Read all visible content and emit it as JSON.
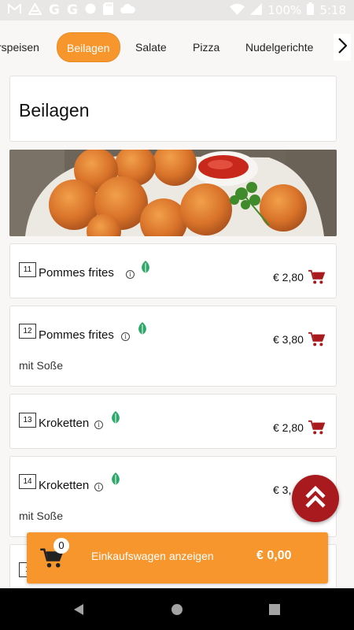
{
  "status_bar": {
    "battery": "100%",
    "time": "5:18",
    "icons": [
      "gmail-icon",
      "drive-icon",
      "google-icon",
      "google-icon",
      "circle-icon",
      "sd-card-icon",
      "cloud-icon",
      "wifi-icon",
      "signal-icon",
      "battery-icon"
    ]
  },
  "categories": [
    {
      "label": "rspeisen",
      "active": false
    },
    {
      "label": "Beilagen",
      "active": true
    },
    {
      "label": "Salate",
      "active": false
    },
    {
      "label": "Pizza",
      "active": false
    },
    {
      "label": "Nudelgerichte",
      "active": false
    }
  ],
  "section": {
    "title": "Beilagen"
  },
  "products": [
    {
      "number": "11",
      "name": "Pommes frites",
      "price": "€ 2,80",
      "description": ""
    },
    {
      "number": "12",
      "name": "Pommes frites",
      "price": "€ 3,80",
      "description": "mit Soße"
    },
    {
      "number": "13",
      "name": "Kroketten",
      "price": "€ 2,80",
      "description": ""
    },
    {
      "number": "14",
      "name": "Kroketten",
      "price": "€ 3,",
      "description": "mit Soße"
    },
    {
      "number": "1",
      "name": "",
      "price": "",
      "description": ""
    }
  ],
  "cart": {
    "count": "0",
    "label": "Einkaufswagen anzeigen",
    "total": "€ 0,00"
  },
  "colors": {
    "accent": "#f7962d",
    "cart_icon": "#a81a1d",
    "leaf": "#2ea86a"
  }
}
